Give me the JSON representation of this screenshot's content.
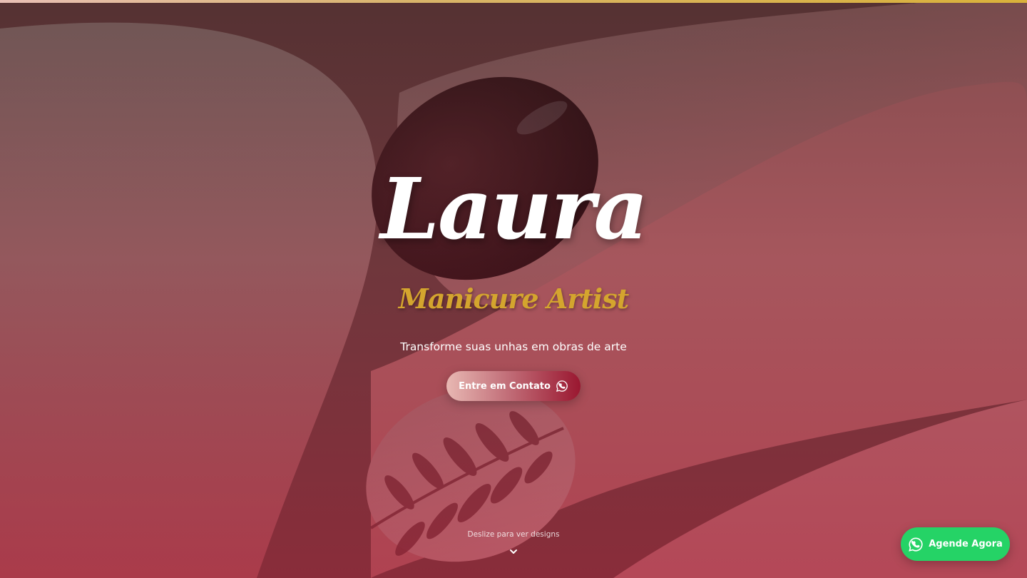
{
  "hero": {
    "brand_name": "Laura",
    "brand_subtitle": "Manicure Artist",
    "tagline": "Transforme suas unhas em obras de arte",
    "cta_label": "Entre em Contato",
    "scroll_hint": "Deslize para ver designs"
  },
  "floating_whatsapp": {
    "label": "Agende Agora"
  },
  "icons": {
    "cta": "whatsapp-icon",
    "scroll": "chevron-down-icon",
    "floating": "whatsapp-icon"
  },
  "colors": {
    "accent_gold": "#d4a52e",
    "cta_gradient_end": "#9a1730",
    "whatsapp_green": "#25d366",
    "overlay_crimson": "#96142d"
  }
}
